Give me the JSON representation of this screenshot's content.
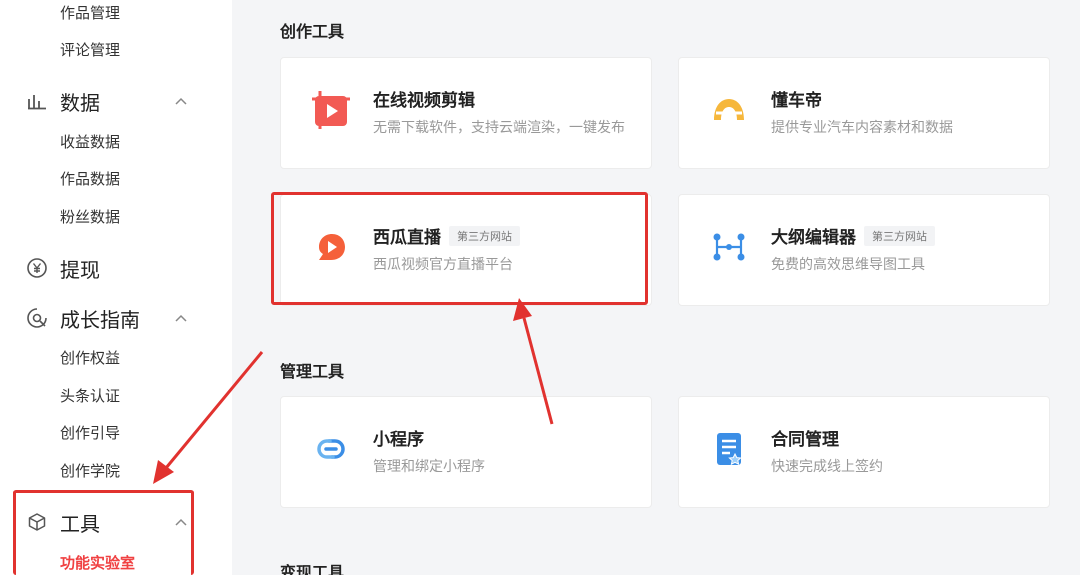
{
  "sidebar": {
    "top_items": [
      "作品管理",
      "评论管理"
    ],
    "groups": {
      "data": {
        "label": "数据",
        "icon": "bar-chart-icon",
        "items": [
          "收益数据",
          "作品数据",
          "粉丝数据"
        ]
      },
      "withdraw": {
        "label": "提现",
        "icon": "yen-icon"
      },
      "growth": {
        "label": "成长指南",
        "icon": "compass-icon",
        "items": [
          "创作权益",
          "头条认证",
          "创作引导",
          "创作学院"
        ]
      },
      "tools": {
        "label": "工具",
        "icon": "box-icon",
        "items": [
          "功能实验室"
        ]
      }
    }
  },
  "main": {
    "sections": {
      "creation": "创作工具",
      "management": "管理工具",
      "monetize": "变现工具"
    },
    "cards": {
      "video_edit": {
        "title": "在线视频剪辑",
        "desc": "无需下载软件，支持云端渲染，一键发布",
        "icon": "video-edit-icon"
      },
      "dongchedi": {
        "title": "懂车帝",
        "desc": "提供专业汽车内容素材和数据",
        "icon": "dongchedi-icon"
      },
      "xigua_live": {
        "title": "西瓜直播",
        "badge": "第三方网站",
        "desc": "西瓜视频官方直播平台",
        "icon": "xigua-icon"
      },
      "outline_editor": {
        "title": "大纲编辑器",
        "badge": "第三方网站",
        "desc": "免费的高效思维导图工具",
        "icon": "mindmap-icon"
      },
      "mini_program": {
        "title": "小程序",
        "desc": "管理和绑定小程序",
        "icon": "link-icon"
      },
      "contract": {
        "title": "合同管理",
        "desc": "快速完成线上签约",
        "icon": "document-icon"
      }
    }
  },
  "colors": {
    "accent": "#f04142",
    "annotation": "#e1322f"
  }
}
